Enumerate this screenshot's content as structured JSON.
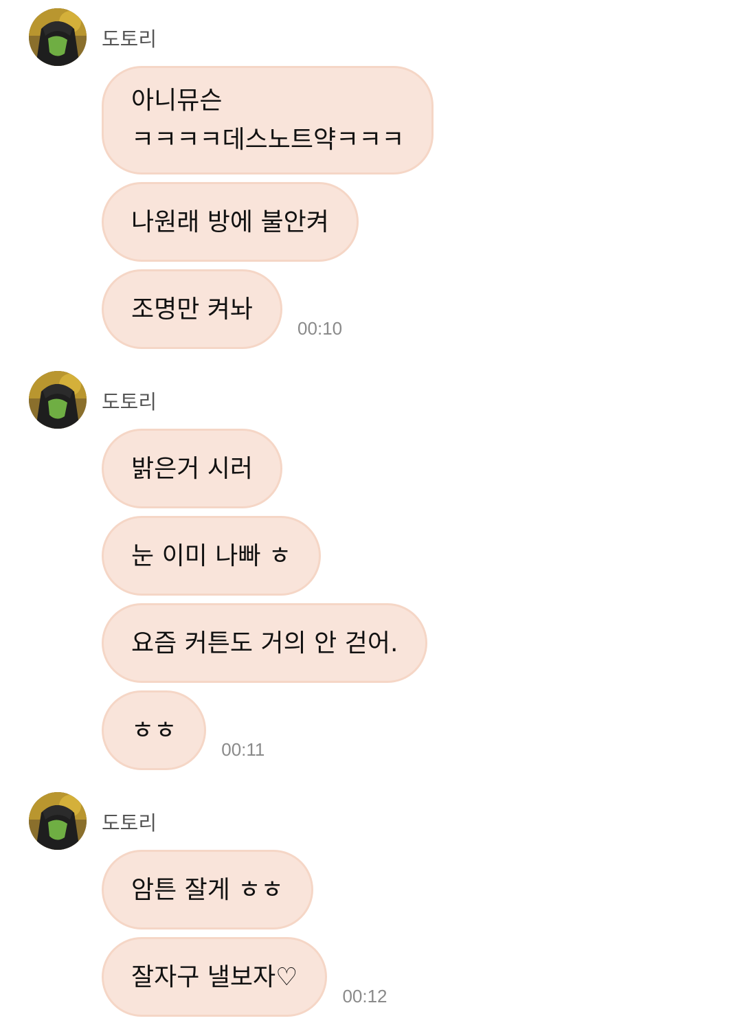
{
  "groups": [
    {
      "sender": "도토리",
      "messages": [
        "아니뮤슨\nㅋㅋㅋㅋ데스노트약ㅋㅋㅋ",
        "나원래 방에 불안켜",
        "조명만 켜놔"
      ],
      "time": "00:10"
    },
    {
      "sender": "도토리",
      "messages": [
        "밝은거 시러",
        "눈 이미 나빠 ㅎ",
        "요즘 커튼도 거의 안 걷어.",
        "ㅎㅎ"
      ],
      "time": "00:11"
    },
    {
      "sender": "도토리",
      "messages": [
        "암튼 잘게 ㅎㅎ",
        "잘자구 낼보자♡"
      ],
      "time": "00:12"
    }
  ],
  "colors": {
    "bubble_bg": "#f9e4da",
    "bubble_border": "#f5d6c6",
    "time_text": "#8a8a8a",
    "sender_text": "#555555"
  }
}
